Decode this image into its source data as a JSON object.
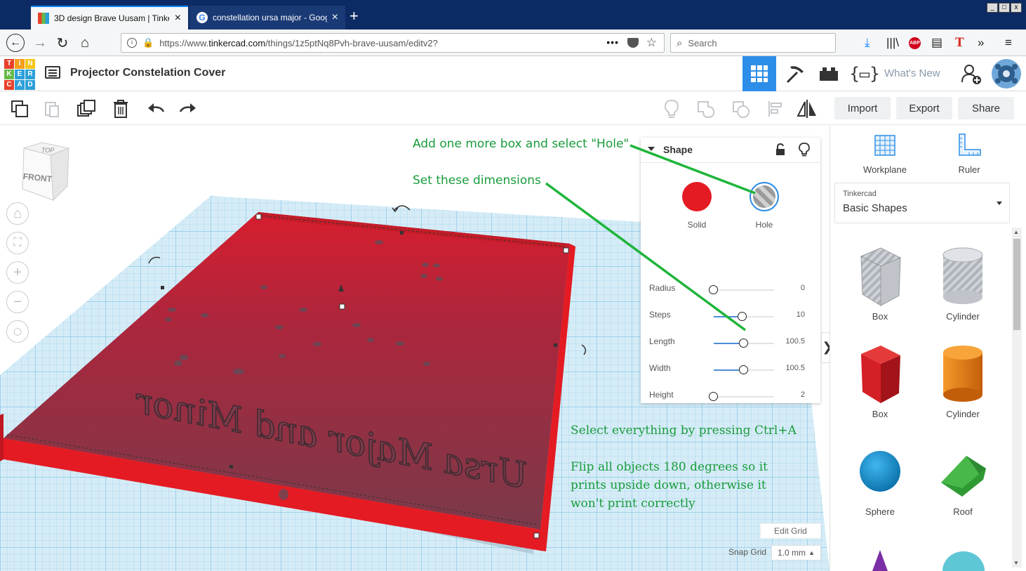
{
  "browser": {
    "tabs": [
      {
        "title": "3D design Brave Uusam | Tinkerca",
        "active": true
      },
      {
        "title": "constellation ursa major - Google S",
        "active": false
      }
    ],
    "new_tab": "+",
    "url_prefix": "https://www.",
    "url_domain": "tinkercad.com",
    "url_path": "/things/1z5ptNq8Pvh-brave-uusam/editv2?",
    "page_actions": "•••",
    "search_placeholder": "Search",
    "window_controls": [
      "_",
      "□",
      "x"
    ]
  },
  "app": {
    "logo_letters": [
      "T",
      "I",
      "N",
      "K",
      "E",
      "R",
      "C",
      "A",
      "D"
    ],
    "logo_colors": [
      "#e8412b",
      "#f59d1b",
      "#f5c518",
      "#67b94a",
      "#2d9fd8",
      "#2d9fd8",
      "#e8412b",
      "#2d9fd8",
      "#2d9fd8"
    ],
    "design_title": "Projector Constelation Cover",
    "whats_new": "What's New",
    "accent": "#2d8ee8"
  },
  "toolbar": {
    "import": "Import",
    "export": "Export",
    "share": "Share"
  },
  "viewcube": {
    "top": "TOP",
    "front": "FRONT"
  },
  "inspector": {
    "title": "Shape",
    "solid_label": "Solid",
    "hole_label": "Hole",
    "solid_color": "#e41b23",
    "props": [
      {
        "label": "Radius",
        "value": "0"
      },
      {
        "label": "Steps",
        "value": "10"
      },
      {
        "label": "Length",
        "value": "100.5"
      },
      {
        "label": "Width",
        "value": "100.5"
      },
      {
        "label": "Height",
        "value": "2"
      }
    ]
  },
  "annotations": {
    "hole_note": "Add one more box and select \"Hole\"",
    "dims_note": "Set these dimensions",
    "select_note": "Select everything by pressing Ctrl+A",
    "flip_note_1": "Flip all objects 180 degrees so it",
    "flip_note_2": "prints upside down, otherwise it",
    "flip_note_3": "won't print correctly"
  },
  "workplane": {
    "engraved_text": "Ursa Major and Minor",
    "edit_grid": "Edit Grid",
    "snap_label": "Snap Grid",
    "snap_value": "1.0 mm"
  },
  "panel": {
    "workplane": "Workplane",
    "ruler": "Ruler",
    "library_owner": "Tinkercad",
    "library_name": "Basic Shapes",
    "shapes": [
      {
        "name": "Box"
      },
      {
        "name": "Cylinder"
      },
      {
        "name": "Box"
      },
      {
        "name": "Cylinder"
      },
      {
        "name": "Sphere"
      },
      {
        "name": "Roof"
      }
    ]
  }
}
